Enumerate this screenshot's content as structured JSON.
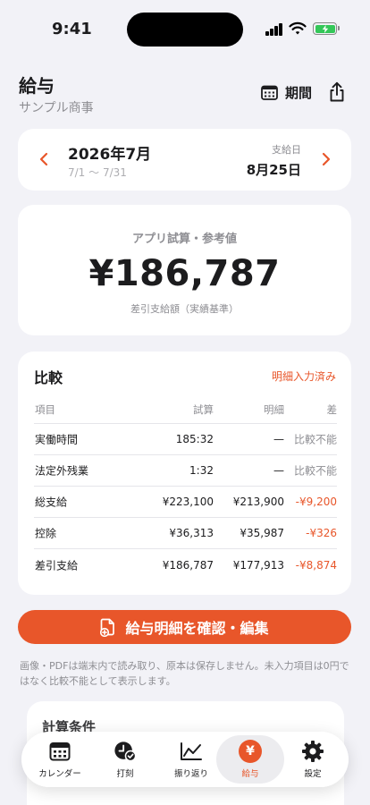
{
  "status": {
    "time": "9:41"
  },
  "header": {
    "title": "給与",
    "company": "サンプル商事",
    "period_label": "期間"
  },
  "month": {
    "label": "2026年7月",
    "range": "7/1 〜 7/31",
    "pay_day_label": "支給日",
    "pay_day": "8月25日"
  },
  "amount": {
    "caption": "アプリ試算・参考値",
    "value": "¥186,787",
    "sub": "差引支給額（実績基準）"
  },
  "comparison": {
    "title": "比較",
    "status": "明細入力済み",
    "headers": [
      "項目",
      "試算",
      "明細",
      "差"
    ],
    "rows": [
      [
        "実働時間",
        "185:32",
        "—",
        "比較不能"
      ],
      [
        "法定外残業",
        "1:32",
        "—",
        "比較不能"
      ],
      [
        "総支給",
        "¥223,100",
        "¥213,900",
        "-¥9,200"
      ],
      [
        "控除",
        "¥36,313",
        "¥35,987",
        "-¥326"
      ],
      [
        "差引支給",
        "¥186,787",
        "¥177,913",
        "-¥8,874"
      ]
    ]
  },
  "primary_button": {
    "label": "給与明細を確認・編集"
  },
  "note": "画像・PDFは端末内で読み取り、原本は保存しません。未入力項目は0円ではなく比較不能として表示します。",
  "conditions": {
    "title": "計算条件"
  },
  "tabs": [
    {
      "label": "カレンダー",
      "icon": "calendar-icon"
    },
    {
      "label": "打刻",
      "icon": "clock-check-icon"
    },
    {
      "label": "振り返り",
      "icon": "line-chart-icon"
    },
    {
      "label": "給与",
      "icon": "yen-icon",
      "selected": true
    },
    {
      "label": "設定",
      "icon": "gear-icon"
    }
  ],
  "colors": {
    "accent": "#e8562a",
    "background": "#f2f2f7",
    "card": "#ffffff",
    "battery": "#34c759"
  }
}
